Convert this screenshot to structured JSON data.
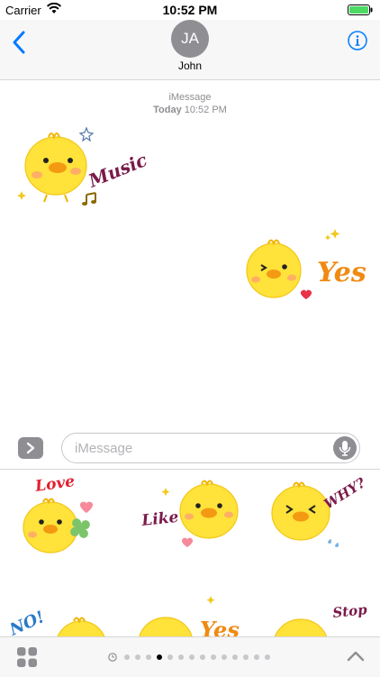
{
  "status_bar": {
    "carrier": "Carrier",
    "time": "10:52 PM"
  },
  "header": {
    "avatar_initials": "JA",
    "contact_name": "John"
  },
  "conversation": {
    "service": "iMessage",
    "day": "Today",
    "time": "10:52 PM",
    "sent_stickers": [
      {
        "word": "Music",
        "icon": "chick-music-sticker"
      },
      {
        "word": "Yes",
        "icon": "chick-yes-sticker"
      }
    ]
  },
  "compose": {
    "placeholder": "iMessage"
  },
  "sticker_drawer": {
    "stickers": [
      {
        "word": "Love",
        "icon": "chick-love-sticker"
      },
      {
        "word": "Like",
        "icon": "chick-like-sticker"
      },
      {
        "word": "WHY?",
        "icon": "chick-why-sticker"
      },
      {
        "word": "NO!",
        "icon": "chick-no-sticker"
      },
      {
        "word": "Yes",
        "icon": "chick-yes-sticker"
      },
      {
        "word": "Stop",
        "icon": "chick-stop-sticker"
      }
    ]
  },
  "bottom_bar": {
    "page_count": 14,
    "active_page": 3
  },
  "colors": {
    "accent": "#007aff",
    "chick": "#ffe23a",
    "music_word": "#7a1a4a",
    "yes_word": "#f08a12",
    "love_word": "#e02030"
  }
}
